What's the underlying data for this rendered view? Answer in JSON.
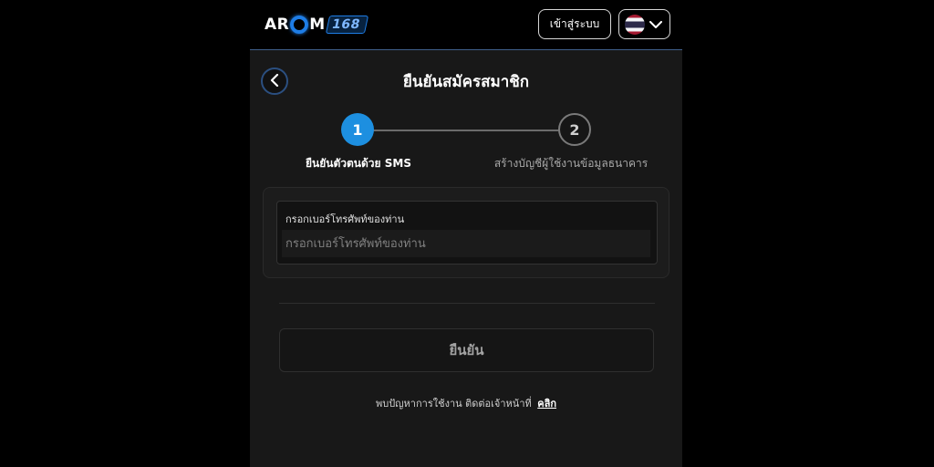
{
  "header": {
    "logo_text_left": "AR",
    "logo_text_mid": "M",
    "logo_number": "168",
    "login_label": "เข้าสู่ระบบ",
    "language_icon": "thai-flag-icon"
  },
  "page": {
    "title": "ยืนยันสมัครสมาชิก",
    "back_icon": "chevron-left-icon"
  },
  "stepper": {
    "steps": [
      {
        "number": "1",
        "label": "ยืนยันตัวตนด้วย SMS",
        "active": true
      },
      {
        "number": "2",
        "label": "สร้างบัญชีผู้ใช้งานข้อมูลธนาคาร",
        "active": false
      }
    ]
  },
  "form": {
    "phone_label": "กรอกเบอร์โทรศัพท์ของท่าน",
    "phone_placeholder": "กรอกเบอร์โทรศัพท์ของท่าน",
    "phone_value": "",
    "confirm_label": "ยืนยัน"
  },
  "help": {
    "text": "พบปัญหาการใช้งาน ติดต่อเจ้าหน้าที่",
    "link_label": "คลิก"
  },
  "colors": {
    "accent": "#1d8fe0",
    "background": "#181818",
    "topbar": "#000000"
  }
}
